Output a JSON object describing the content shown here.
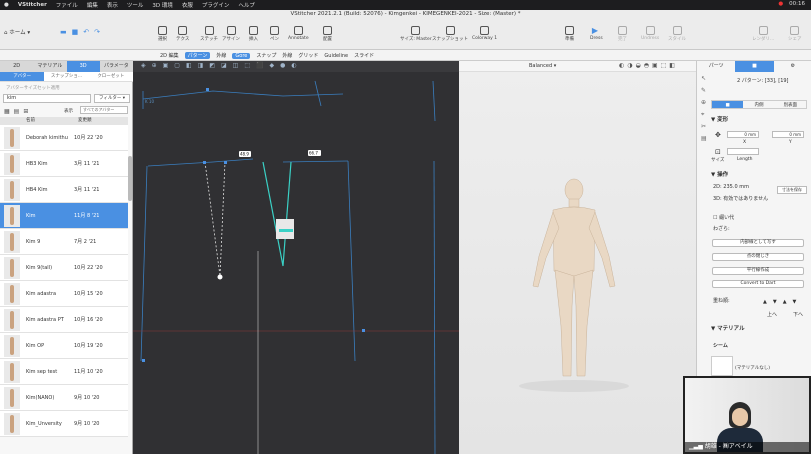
{
  "mac_menu": {
    "app": "VStitcher",
    "items": [
      "ファイル",
      "編集",
      "表示",
      "ツール",
      "3D 環境",
      "衣服",
      "プラグイン",
      "ヘルプ"
    ],
    "clock": "00:16"
  },
  "window": {
    "title": "VStitcher 2021.2.1 (Build: 52076) - Kimgenkei - KIMEGENKEI-2021 - Size: (Master) *"
  },
  "toolbar": {
    "home": "ホーム",
    "tools": [
      "選択",
      "テクス",
      "ステッチ",
      "アサイン",
      "挿入",
      "ペン",
      "Annotate",
      "配置"
    ],
    "size": "サイズ: Master",
    "snapshot": "スナップショット",
    "colorway": "Colorway 1",
    "right": [
      "準備",
      "Dress",
      "完了",
      "Undress",
      "スタイル",
      "レンダリ...",
      "シェア"
    ]
  },
  "subtoolbar": {
    "items": [
      "2D 編集",
      "パターン",
      "外線",
      "Gore",
      "スナップ",
      "外線",
      "グリッド",
      "Guideline",
      "スライド"
    ],
    "balanced": "Balanced"
  },
  "left_panel": {
    "tabs": [
      "2D",
      "マテリアル",
      "3D",
      "パラメータ"
    ],
    "subtabs": [
      "アバター",
      "スナップショ...",
      "クローゼット"
    ],
    "filter_hint": "アバターサイズセット適用",
    "search": "kim",
    "filter_btn": "フィルター",
    "sort_label": "表示",
    "sort_value": "すべてのアバター",
    "col_name": "名前",
    "col_date": "変更順",
    "rows": [
      {
        "name": "Deborah kimithu",
        "date": "10月 22 '20"
      },
      {
        "name": "HB3 Kim",
        "date": "3月 11 '21"
      },
      {
        "name": "HB4 Kim",
        "date": "3月 11 '21"
      },
      {
        "name": "Kim",
        "date": "11月 8 '21"
      },
      {
        "name": "Kim 9",
        "date": "7月 2 '21"
      },
      {
        "name": "Kim 9(tall)",
        "date": "10月 22 '20"
      },
      {
        "name": "Kim adastra",
        "date": "10月 15 '20"
      },
      {
        "name": "Kim adastra PT",
        "date": "10月 16 '20"
      },
      {
        "name": "Kim OP",
        "date": "10月 19 '20"
      },
      {
        "name": "Kim sep test",
        "date": "11月 10 '20"
      },
      {
        "name": "Kim(NANO)",
        "date": "9月 10 '20"
      },
      {
        "name": "Kim_Unversity",
        "date": "9月 10 '20"
      }
    ]
  },
  "pattern": {
    "measure_1": "48.9",
    "measure_2": "66.7",
    "label": "K 10"
  },
  "right_panel": {
    "tabs": [
      "パーツ",
      "",
      "",
      ""
    ],
    "pattern_count": "2 パターン: [33], [19]",
    "subtabs": [
      "",
      "内側",
      "別表面"
    ],
    "section_transform": "▼ 変形",
    "x_label": "X",
    "y_label": "Y",
    "size_label": "サイズ",
    "length_label": "Length",
    "x_val": "0 mm",
    "y_val": "0 mm",
    "section_ops": "▼ 操作",
    "area_2d": "2D: 235.0 mm",
    "area_3d": "3D: 有効ではありません",
    "save_size": "寸法を保存",
    "fold_check": "綴い代",
    "width_label": "わざら:",
    "btn_inside": "内部線として写す",
    "btn_split": "点の閉じき",
    "btn_parallel": "平行線作成",
    "btn_dart": "Convert to Dart",
    "stack_label": "重ね順:",
    "up": "上へ",
    "down": "下へ",
    "section_material": "▼ マテリアル",
    "seam": "シーム",
    "no_material": "(マテリアルなし)"
  },
  "camera": {
    "caption": "胡雄 - ㈱アベイル"
  }
}
